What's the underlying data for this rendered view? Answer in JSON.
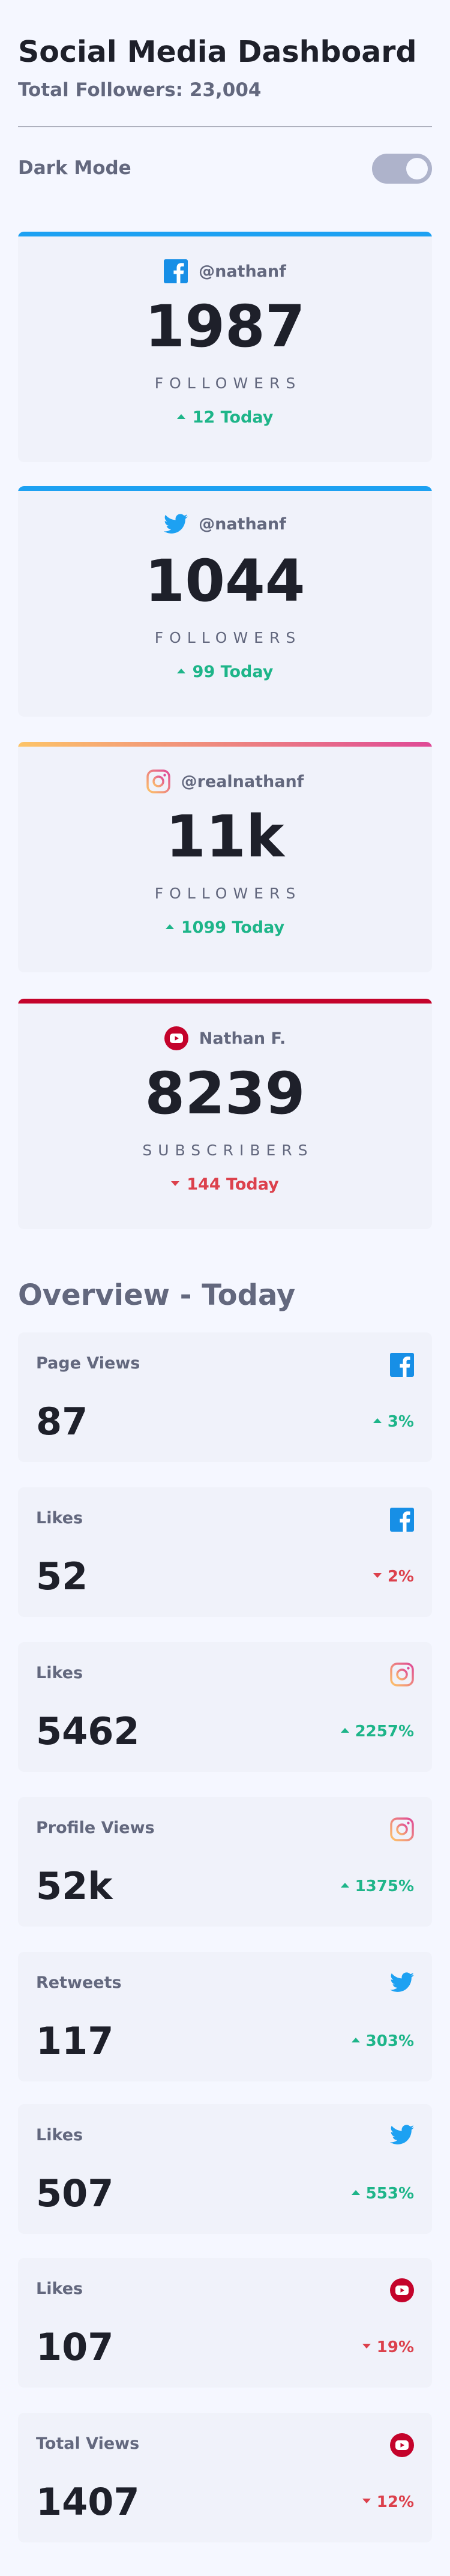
{
  "header": {
    "title": "Social Media Dashboard",
    "total_followers": "Total Followers: 23,004"
  },
  "theme": {
    "label": "Dark Mode",
    "dark_mode_on": false
  },
  "colors": {
    "up": "#1eb589",
    "down": "#dc414c",
    "facebook": "#178fe6",
    "twitter": "#1da1f2",
    "youtube": "#c4032b",
    "instagram_start": "#fdc468",
    "instagram_end": "#df4996"
  },
  "follower_cards": [
    {
      "platform": "facebook",
      "icon": "facebook-icon",
      "handle": "@nathanf",
      "count": "1987",
      "label": "FOLLOWERS",
      "delta": "12 Today",
      "trend": "up"
    },
    {
      "platform": "twitter",
      "icon": "twitter-icon",
      "handle": "@nathanf",
      "count": "1044",
      "label": "FOLLOWERS",
      "delta": "99 Today",
      "trend": "up"
    },
    {
      "platform": "instagram",
      "icon": "instagram-icon",
      "handle": "@realnathanf",
      "count": "11k",
      "label": "FOLLOWERS",
      "delta": "1099 Today",
      "trend": "up"
    },
    {
      "platform": "youtube",
      "icon": "youtube-icon",
      "handle": "Nathan F.",
      "count": "8239",
      "label": "SUBSCRIBERS",
      "delta": "144 Today",
      "trend": "down"
    }
  ],
  "overview": {
    "title": "Overview - Today",
    "cards": [
      {
        "label": "Page Views",
        "icon": "facebook-icon",
        "value": "87",
        "delta": "3%",
        "trend": "up"
      },
      {
        "label": "Likes",
        "icon": "facebook-icon",
        "value": "52",
        "delta": "2%",
        "trend": "down"
      },
      {
        "label": "Likes",
        "icon": "instagram-icon",
        "value": "5462",
        "delta": "2257%",
        "trend": "up"
      },
      {
        "label": "Profile Views",
        "icon": "instagram-icon",
        "value": "52k",
        "delta": "1375%",
        "trend": "up"
      },
      {
        "label": "Retweets",
        "icon": "twitter-icon",
        "value": "117",
        "delta": "303%",
        "trend": "up"
      },
      {
        "label": "Likes",
        "icon": "twitter-icon",
        "value": "507",
        "delta": "553%",
        "trend": "up"
      },
      {
        "label": "Likes",
        "icon": "youtube-icon",
        "value": "107",
        "delta": "19%",
        "trend": "down"
      },
      {
        "label": "Total Views",
        "icon": "youtube-icon",
        "value": "1407",
        "delta": "12%",
        "trend": "down"
      }
    ]
  }
}
